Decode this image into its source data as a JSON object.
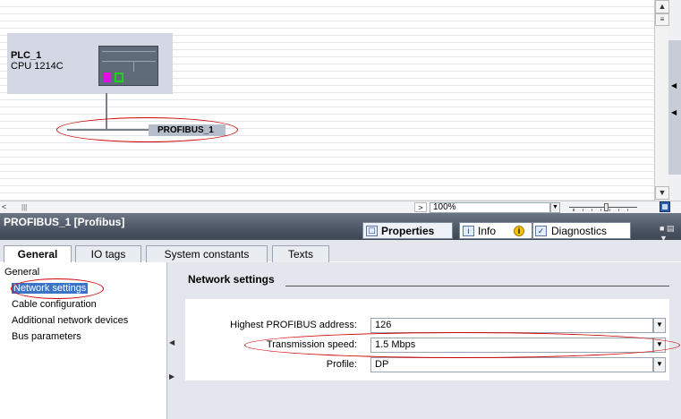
{
  "canvas": {
    "plc_name": "PLC_1",
    "plc_type": "CPU 1214C",
    "bus_label": "PROFIBUS_1"
  },
  "toolbar": {
    "zoom_value": "100%"
  },
  "inspector": {
    "title": "PROFIBUS_1 [Profibus]",
    "tabs": {
      "properties": "Properties",
      "info": "Info",
      "diagnostics": "Diagnostics"
    },
    "subtabs": [
      "General",
      "IO tags",
      "System constants",
      "Texts"
    ],
    "nav": [
      "General",
      "Network settings",
      "Cable configuration",
      "Additional network devices",
      "Bus parameters"
    ],
    "section_title": "Network settings",
    "fields": {
      "address_label": "Highest PROFIBUS address:",
      "address_value": "126",
      "speed_label": "Transmission speed:",
      "speed_value": "1.5 Mbps",
      "profile_label": "Profile:",
      "profile_value": "DP"
    }
  },
  "colors": {
    "selection": "#3b73c9",
    "annotation": "#d00000",
    "header": "#4e5866"
  }
}
